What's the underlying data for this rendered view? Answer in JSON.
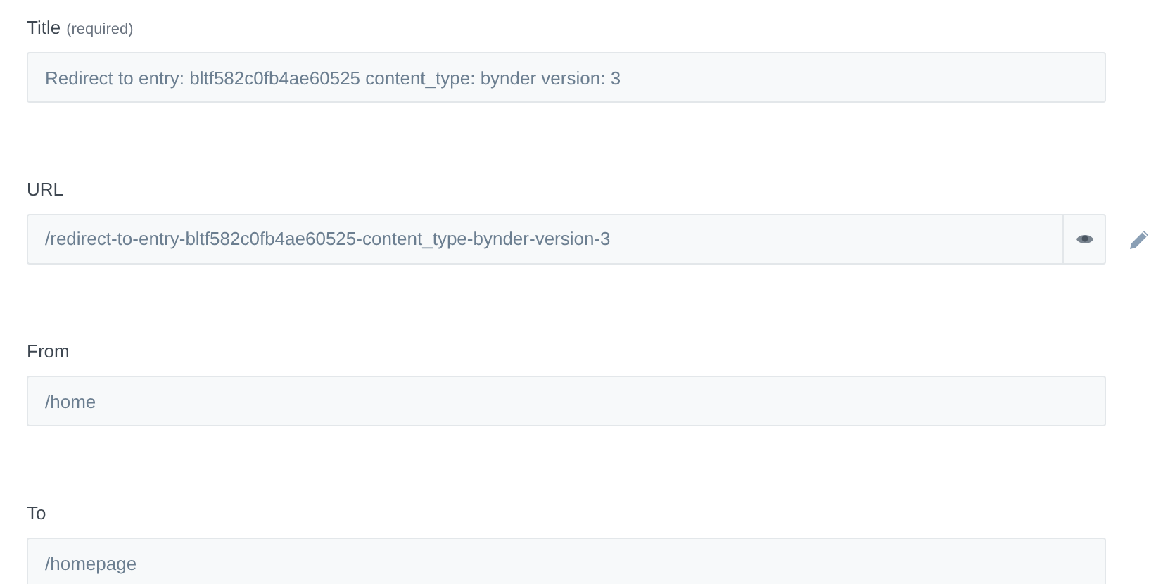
{
  "fields": [
    {
      "kind": "text",
      "label": "Title",
      "hint": "(required)",
      "value": "Redirect to entry: bltf582c0fb4ae60525 content_type: bynder version: 3"
    },
    {
      "kind": "url",
      "label": "URL",
      "value": "/redirect-to-entry-bltf582c0fb4ae60525-content_type-bynder-version-3"
    },
    {
      "kind": "text",
      "label": "From",
      "value": "/home"
    },
    {
      "kind": "text",
      "label": "To",
      "value": "/homepage"
    }
  ]
}
